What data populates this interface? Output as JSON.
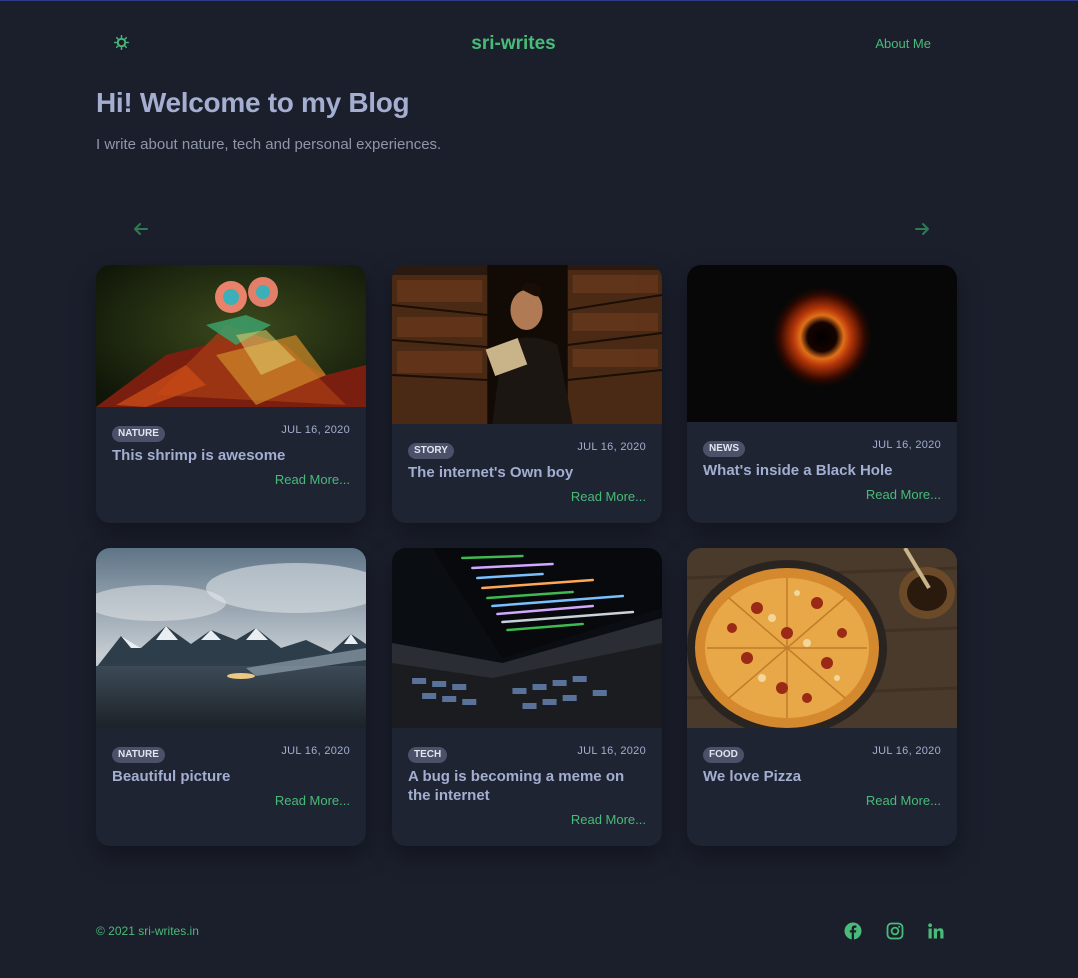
{
  "header": {
    "site_title": "sri-writes",
    "about_label": "About Me"
  },
  "hero": {
    "title": "Hi! Welcome to my Blog",
    "subtitle": "I write about nature, tech and personal experiences."
  },
  "carousel": {
    "prev_icon": "arrow-left-icon",
    "next_icon": "arrow-right-icon"
  },
  "posts": [
    {
      "category": "NATURE",
      "date": "JUL 16, 2020",
      "title": "This shrimp is awesome",
      "read_more": "Read More...",
      "image": "mantis-shrimp-photo"
    },
    {
      "category": "STORY",
      "date": "JUL 16, 2020",
      "title": "The internet's Own boy",
      "read_more": "Read More...",
      "image": "man-reading-in-library-photo"
    },
    {
      "category": "NEWS",
      "date": "JUL 16, 2020",
      "title": "What's inside a Black Hole",
      "read_more": "Read More...",
      "image": "black-hole-photo"
    },
    {
      "category": "NATURE",
      "date": "JUL 16, 2020",
      "title": "Beautiful picture",
      "read_more": "Read More...",
      "image": "snowy-mountains-photo"
    },
    {
      "category": "TECH",
      "date": "JUL 16, 2020",
      "title": "A bug is becoming a meme on the internet",
      "read_more": "Read More...",
      "image": "laptop-code-photo"
    },
    {
      "category": "FOOD",
      "date": "JUL 16, 2020",
      "title": "We love Pizza",
      "read_more": "Read More...",
      "image": "pizza-photo"
    }
  ],
  "footer": {
    "copyright": "© 2021 sri-writes.in",
    "socials": [
      "facebook-icon",
      "instagram-icon",
      "linkedin-icon"
    ]
  },
  "colors": {
    "background": "#1b1f2c",
    "card": "#1f2433",
    "accent": "#48bb78",
    "heading": "#a3aed0",
    "badge": "#4a5168"
  }
}
